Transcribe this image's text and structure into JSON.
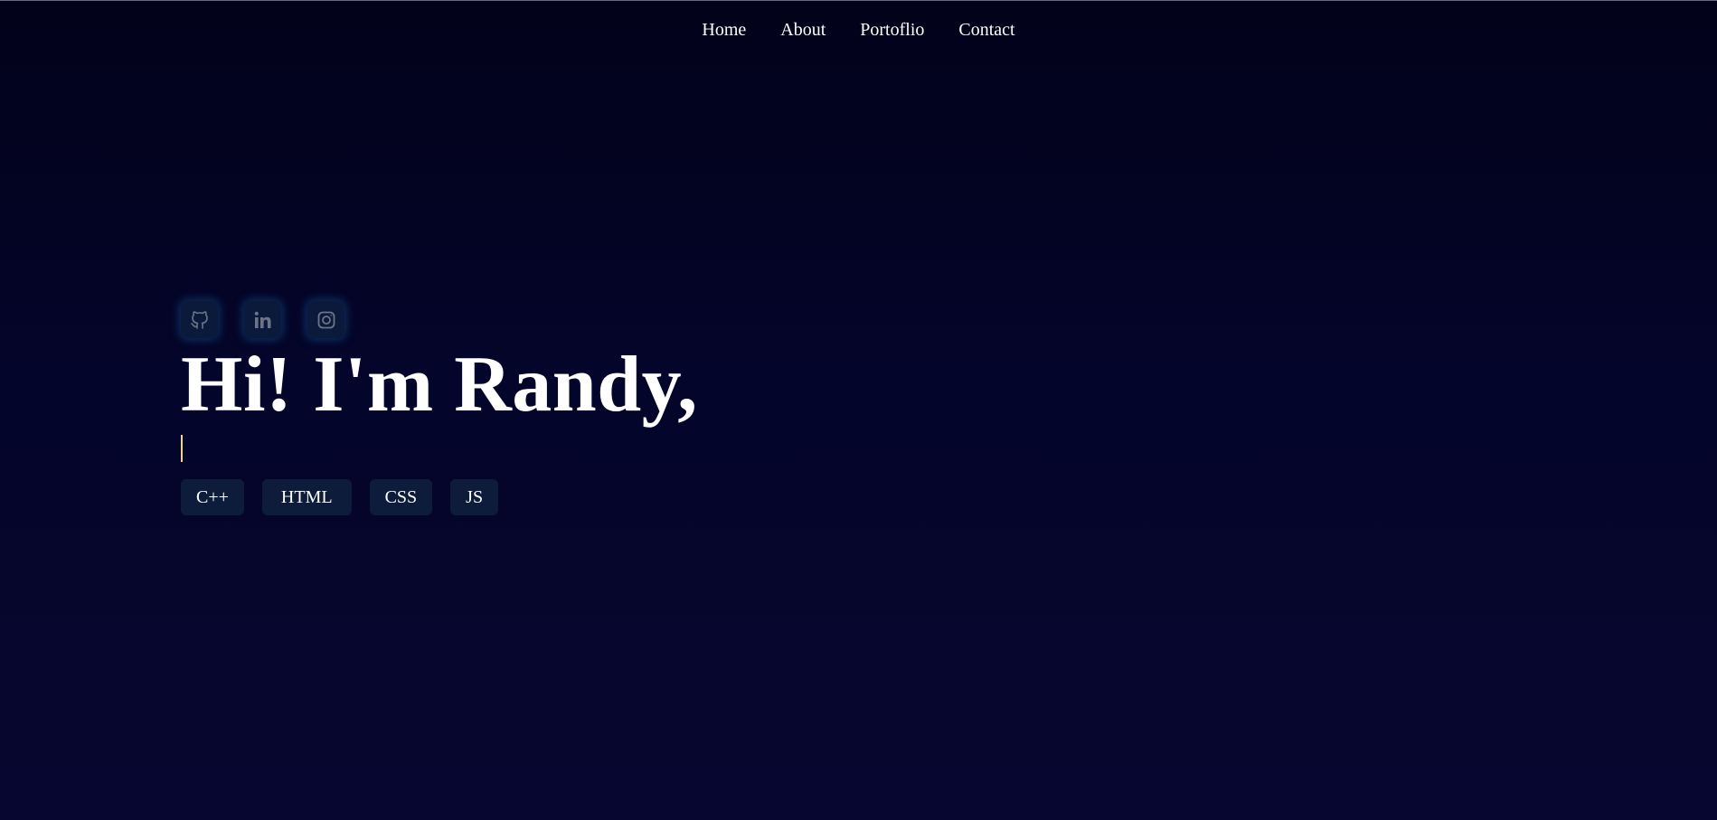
{
  "nav": {
    "items": [
      {
        "label": "Home"
      },
      {
        "label": "About"
      },
      {
        "label": "Portoflio"
      },
      {
        "label": "Contact"
      }
    ]
  },
  "hero": {
    "socials": [
      {
        "icon": "github-icon"
      },
      {
        "icon": "linkedin-icon"
      },
      {
        "icon": "instagram-icon"
      }
    ],
    "title": "Hi! I'm Randy,",
    "typed_text": "",
    "skills": [
      "C++",
      "HTML",
      "CSS",
      "JS"
    ]
  },
  "colors": {
    "background_top": "#02021a",
    "background_bottom": "#070630",
    "chip_bg": "#0e1c3c",
    "social_glow": "#145a96",
    "caret": "#f3d28a",
    "icon": "#6e7387"
  }
}
